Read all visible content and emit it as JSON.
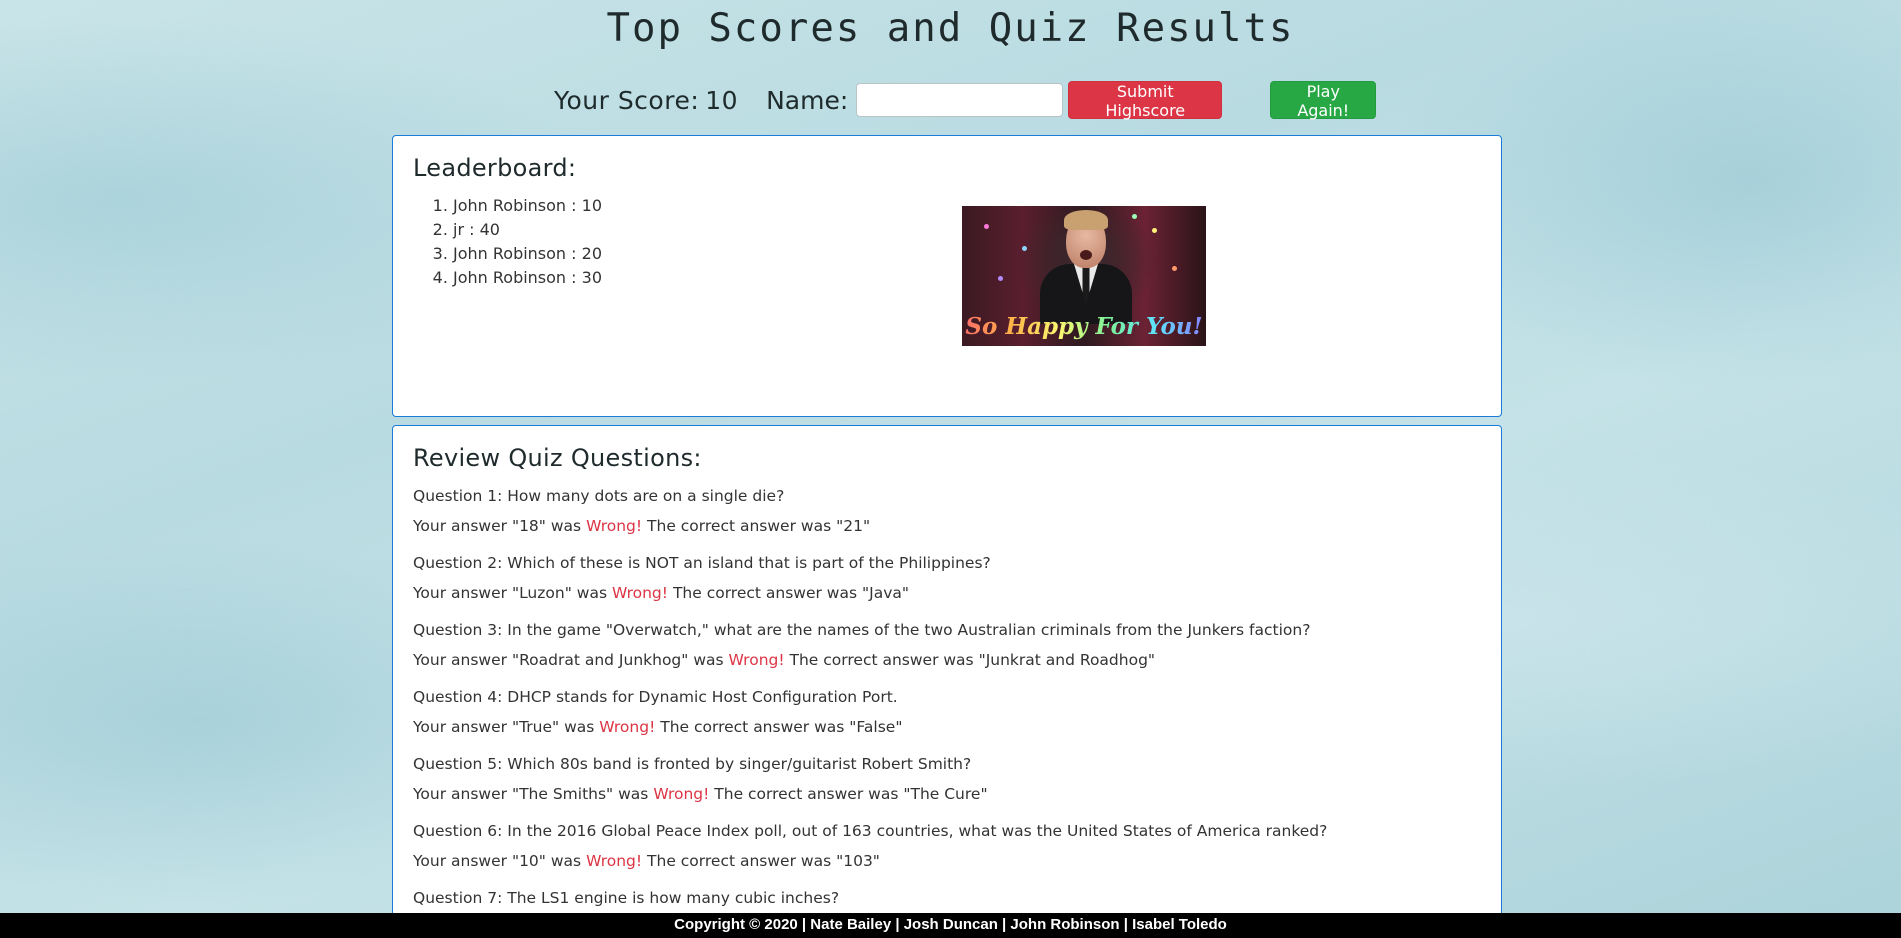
{
  "page": {
    "title": "Top Scores and Quiz Results"
  },
  "score_bar": {
    "score_label": "Your Score:",
    "score_value": "10",
    "name_label": "Name:",
    "name_value": "",
    "submit_label": "Submit Highscore",
    "play_again_label": "Play Again!"
  },
  "leaderboard": {
    "heading": "Leaderboard:",
    "entries": [
      "John Robinson : 10",
      "jr : 40",
      "John Robinson : 20",
      "John Robinson : 30"
    ],
    "gif_caption": "So Happy For You!"
  },
  "review": {
    "heading": "Review Quiz Questions:",
    "answer_prefix": "Your answer",
    "answer_was": "was",
    "wrong_label": "Wrong!",
    "correct_prefix": "The correct answer was",
    "items": [
      {
        "question": "Question 1: How many dots are on a single die?",
        "your_answer": "\"18\"",
        "correct_answer": "\"21\""
      },
      {
        "question": "Question 2: Which of these is NOT an island that is part of the Philippines?",
        "your_answer": "\"Luzon\"",
        "correct_answer": "\"Java\""
      },
      {
        "question": "Question 3: In the game \"Overwatch,\" what are the names of the two Australian criminals from the Junkers faction?",
        "your_answer": "\"Roadrat and Junkhog\"",
        "correct_answer": "\"Junkrat and Roadhog\""
      },
      {
        "question": "Question 4: DHCP stands for Dynamic Host Configuration Port.",
        "your_answer": "\"True\"",
        "correct_answer": "\"False\""
      },
      {
        "question": "Question 5: Which 80s band is fronted by singer/guitarist Robert Smith?",
        "your_answer": "\"The Smiths\"",
        "correct_answer": "\"The Cure\""
      },
      {
        "question": "Question 6: In the 2016 Global Peace Index poll, out of 163 countries, what was the United States of America ranked?",
        "your_answer": "\"10\"",
        "correct_answer": "\"103\""
      },
      {
        "question": "Question 7: The LS1 engine is how many cubic inches?",
        "your_answer": "",
        "correct_answer": ""
      }
    ]
  },
  "footer": {
    "text": "Copyright © 2020 | Nate Bailey | Josh Duncan | John Robinson | Isabel Toledo"
  },
  "colors": {
    "card_border": "#1a7bd8",
    "submit_button": "#dc3545",
    "play_button": "#28a745",
    "wrong_text": "#dc3545",
    "footer_bg": "#000000"
  }
}
